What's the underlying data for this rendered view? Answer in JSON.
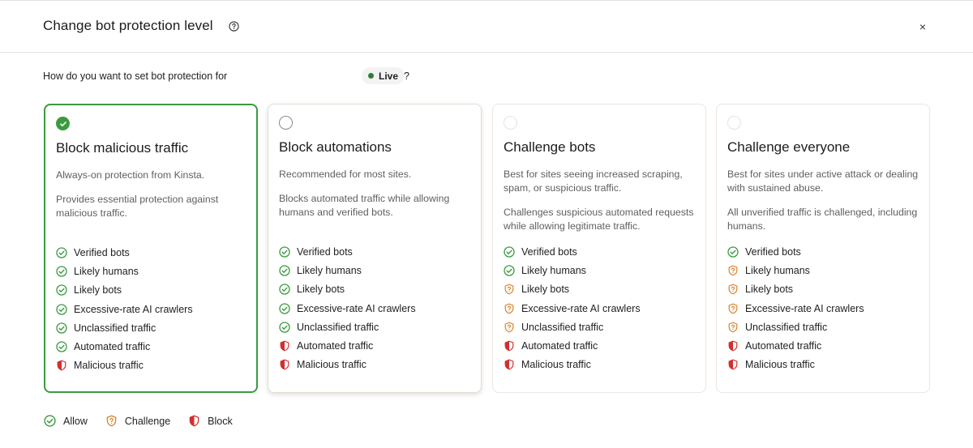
{
  "dialog": {
    "title": "Change bot protection level",
    "close_label": "×",
    "question": "How do you want to set bot protection for",
    "environment": "Live",
    "question_mark": "?"
  },
  "cards": [
    {
      "title": "Block malicious traffic",
      "desc1": "Always-on protection from Kinsta.",
      "desc2": "Provides essential protection against malicious traffic.",
      "state": "selected",
      "rules": [
        {
          "label": "Verified bots",
          "action": "allow"
        },
        {
          "label": "Likely humans",
          "action": "allow"
        },
        {
          "label": "Likely bots",
          "action": "allow"
        },
        {
          "label": "Excessive-rate AI crawlers",
          "action": "allow"
        },
        {
          "label": "Unclassified traffic",
          "action": "allow"
        },
        {
          "label": "Automated traffic",
          "action": "allow"
        },
        {
          "label": "Malicious traffic",
          "action": "block"
        }
      ]
    },
    {
      "title": "Block automations",
      "desc1": "Recommended for most sites.",
      "desc2": "Blocks automated traffic while allowing humans and verified bots.",
      "state": "hovered",
      "rules": [
        {
          "label": "Verified bots",
          "action": "allow"
        },
        {
          "label": "Likely humans",
          "action": "allow"
        },
        {
          "label": "Likely bots",
          "action": "allow"
        },
        {
          "label": "Excessive-rate AI crawlers",
          "action": "allow"
        },
        {
          "label": "Unclassified traffic",
          "action": "allow"
        },
        {
          "label": "Automated traffic",
          "action": "block"
        },
        {
          "label": "Malicious traffic",
          "action": "block"
        }
      ]
    },
    {
      "title": "Challenge bots",
      "desc1": "Best for sites seeing increased scraping, spam, or suspicious traffic.",
      "desc2": "Challenges suspicious automated requests while allowing legitimate traffic.",
      "state": "unselected",
      "rules": [
        {
          "label": "Verified bots",
          "action": "allow"
        },
        {
          "label": "Likely humans",
          "action": "allow"
        },
        {
          "label": "Likely bots",
          "action": "challenge"
        },
        {
          "label": "Excessive-rate AI crawlers",
          "action": "challenge"
        },
        {
          "label": "Unclassified traffic",
          "action": "challenge"
        },
        {
          "label": "Automated traffic",
          "action": "block"
        },
        {
          "label": "Malicious traffic",
          "action": "block"
        }
      ]
    },
    {
      "title": "Challenge everyone",
      "desc1": "Best for sites under active attack or dealing with sustained abuse.",
      "desc2": "All unverified traffic is challenged, including humans.",
      "state": "unselected",
      "rules": [
        {
          "label": "Verified bots",
          "action": "allow"
        },
        {
          "label": "Likely humans",
          "action": "challenge"
        },
        {
          "label": "Likely bots",
          "action": "challenge"
        },
        {
          "label": "Excessive-rate AI crawlers",
          "action": "challenge"
        },
        {
          "label": "Unclassified traffic",
          "action": "challenge"
        },
        {
          "label": "Automated traffic",
          "action": "block"
        },
        {
          "label": "Malicious traffic",
          "action": "block"
        }
      ]
    }
  ],
  "legend": {
    "allow": "Allow",
    "challenge": "Challenge",
    "block": "Block"
  },
  "colors": {
    "allow": "#3a9b3f",
    "challenge": "#d9822b",
    "block": "#d32f2f",
    "selected_border": "#3a9b3f",
    "live_dot": "#2f7d32"
  },
  "icons": {
    "allow": "check-circle-icon",
    "challenge": "shield-question-icon",
    "block": "shield-half-icon"
  }
}
